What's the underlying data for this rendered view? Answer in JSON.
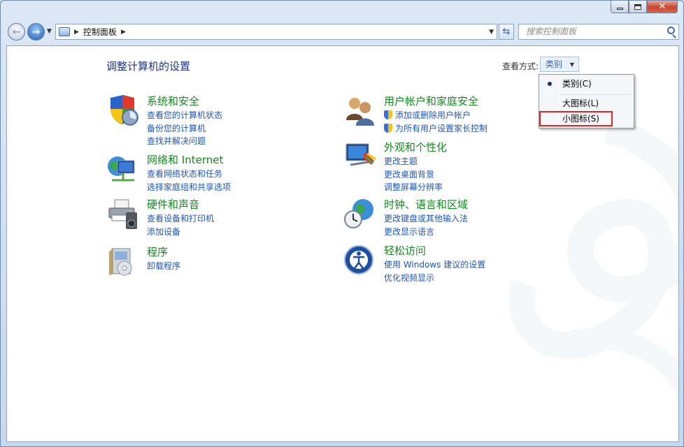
{
  "window": {
    "caption_buttons": [
      "minimize",
      "maximize",
      "close"
    ]
  },
  "navbar": {
    "breadcrumb": "控制面板",
    "search_placeholder": "搜索控制面板"
  },
  "page": {
    "title": "调整计算机的设置",
    "view_by_label": "查看方式:",
    "view_by_value": "类别"
  },
  "view_menu": {
    "items": [
      {
        "label": "类别(C)",
        "selected": true
      },
      {
        "label": "大图标(L)",
        "selected": false
      },
      {
        "label": "小图标(S)",
        "selected": false,
        "highlighted": true
      }
    ]
  },
  "categories": [
    {
      "title": "系统和安全",
      "icon": "shield-icon",
      "links": [
        {
          "text": "查看您的计算机状态",
          "shield": false
        },
        {
          "text": "备份您的计算机",
          "shield": false
        },
        {
          "text": "查找并解决问题",
          "shield": false
        }
      ]
    },
    {
      "title": "网络和 Internet",
      "icon": "network-globe-icon",
      "links": [
        {
          "text": "查看网络状态和任务",
          "shield": false
        },
        {
          "text": "选择家庭组和共享选项",
          "shield": false
        }
      ]
    },
    {
      "title": "硬件和声音",
      "icon": "printer-icon",
      "links": [
        {
          "text": "查看设备和打印机",
          "shield": false
        },
        {
          "text": "添加设备",
          "shield": false
        }
      ]
    },
    {
      "title": "程序",
      "icon": "programs-icon",
      "links": [
        {
          "text": "卸载程序",
          "shield": false
        }
      ]
    },
    {
      "title": "用户帐户和家庭安全",
      "icon": "users-icon",
      "links": [
        {
          "text": "添加或删除用户帐户",
          "shield": true
        },
        {
          "text": "为所有用户设置家长控制",
          "shield": true
        }
      ]
    },
    {
      "title": "外观和个性化",
      "icon": "monitor-paint-icon",
      "links": [
        {
          "text": "更改主题",
          "shield": false
        },
        {
          "text": "更改桌面背景",
          "shield": false
        },
        {
          "text": "调整屏幕分辨率",
          "shield": false
        }
      ]
    },
    {
      "title": "时钟、语言和区域",
      "icon": "clock-globe-icon",
      "links": [
        {
          "text": "更改键盘或其他输入法",
          "shield": false
        },
        {
          "text": "更改显示语言",
          "shield": false
        }
      ]
    },
    {
      "title": "轻松访问",
      "icon": "ease-of-access-icon",
      "links": [
        {
          "text": "使用 Windows 建议的设置",
          "shield": false
        },
        {
          "text": "优化视频显示",
          "shield": false
        }
      ]
    }
  ],
  "colors": {
    "category_title": "#14881f",
    "link": "#1f56b7",
    "page_title": "#1e3287",
    "highlight_box": "#e0232a"
  }
}
